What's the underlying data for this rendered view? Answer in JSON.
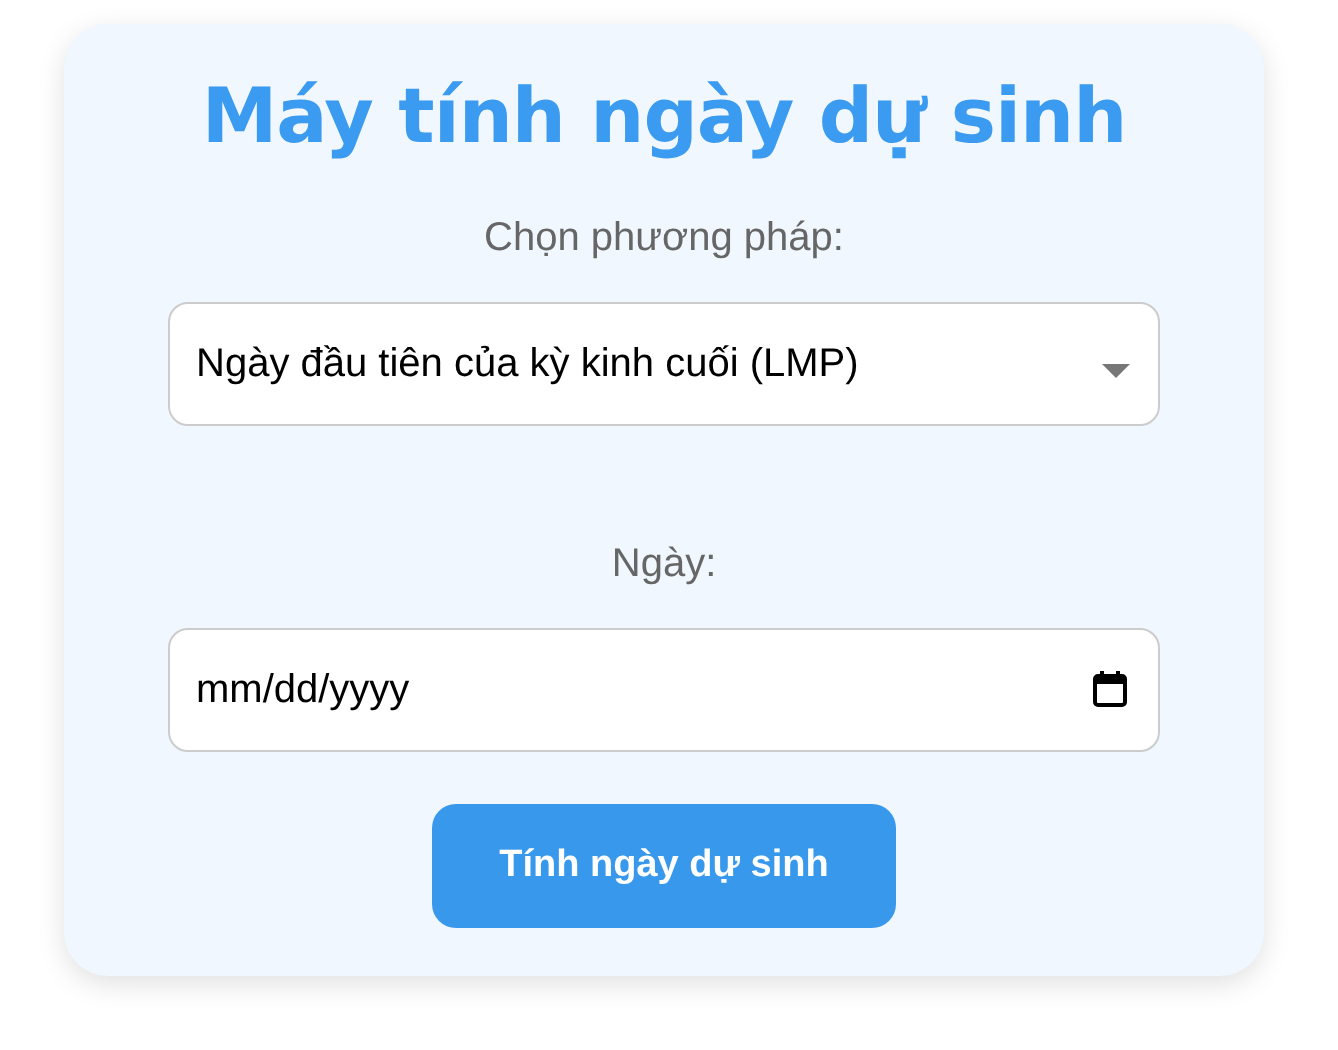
{
  "title": "Máy tính ngày dự sinh",
  "method": {
    "label": "Chọn phương pháp:",
    "value": "Ngày đầu tiên của kỳ kinh cuối (LMP)"
  },
  "date": {
    "label": "Ngày:",
    "placeholder": "mm/dd/yyyy"
  },
  "submit_button": "Tính ngày dự sinh"
}
